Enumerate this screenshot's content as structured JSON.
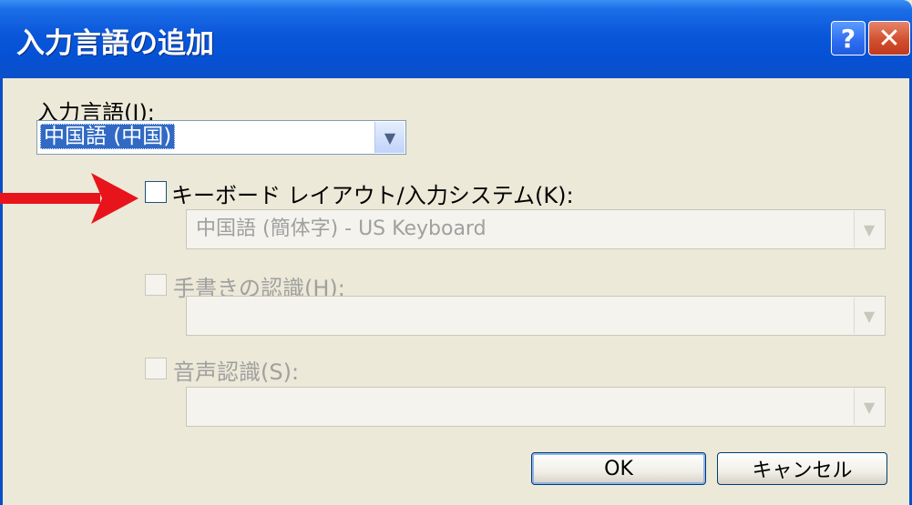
{
  "window": {
    "title": "入力言語の追加",
    "help_glyph": "?",
    "close_glyph": "✕"
  },
  "input_language": {
    "label": "入力言語(I):",
    "selected": "中国語 (中国)"
  },
  "keyboard_layout": {
    "label": "キーボード レイアウト/入力システム(K):",
    "value": "中国語 (簡体字) - US Keyboard",
    "checked": false
  },
  "handwriting": {
    "label": "手書きの認識(H):",
    "value": "",
    "checked": false
  },
  "speech": {
    "label": "音声認識(S):",
    "value": "",
    "checked": false
  },
  "buttons": {
    "ok": "OK",
    "cancel": "キャンセル"
  },
  "icons": {
    "dropdown": "chevron-down-icon",
    "annotation": "red-arrow-icon"
  },
  "colors": {
    "titlebar": "#0b4fc8",
    "dialog_bg": "#ece9d8",
    "selection": "#316ac5",
    "annotation_arrow": "#e8141c"
  }
}
